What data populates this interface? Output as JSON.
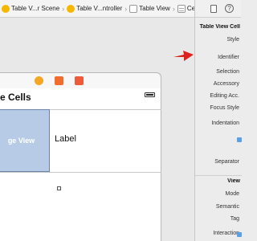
{
  "breadcrumbs": [
    {
      "label": "Table V...r Scene",
      "icon": "storyboard-scene-icon"
    },
    {
      "label": "Table V...ntroller",
      "icon": "view-controller-icon"
    },
    {
      "label": "Table View",
      "icon": "table-view-icon"
    },
    {
      "label": "Cell",
      "icon": "table-cell-icon"
    }
  ],
  "canvas": {
    "section_title": "e Cells",
    "image_view_label": "ge View",
    "cell_label": "Label"
  },
  "inspector": {
    "tabs": [
      {
        "icon": "file-inspector-icon"
      },
      {
        "icon": "help-icon",
        "glyph": "?"
      }
    ],
    "table_view_cell": {
      "title": "Table View Cell",
      "rows": [
        "Style",
        "Identifier",
        "Selection",
        "Accessory",
        "Editing Acc.",
        "Focus Style",
        "Indentation",
        "Separator"
      ]
    },
    "view": {
      "title": "View",
      "rows": [
        "Mode",
        "Semantic",
        "Tag",
        "Interaction"
      ]
    }
  },
  "colors": {
    "arrow": "#e0201b",
    "image_view_fill": "#b8cbe6"
  }
}
